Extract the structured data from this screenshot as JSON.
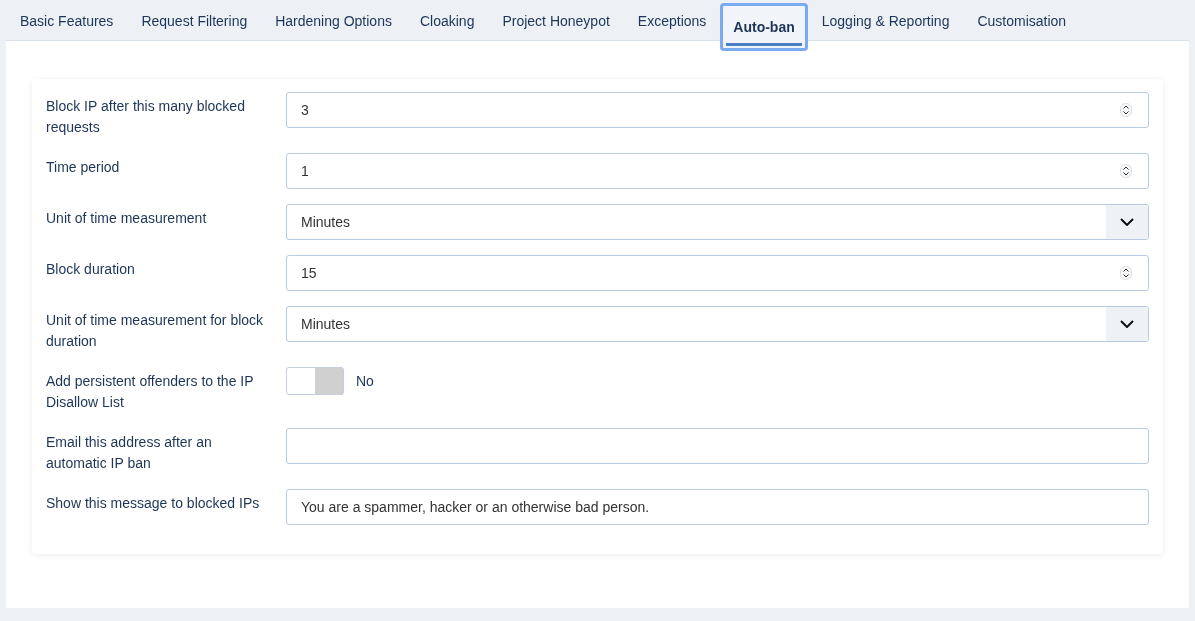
{
  "tabs": [
    {
      "label": "Basic Features",
      "selected": false
    },
    {
      "label": "Request Filtering",
      "selected": false
    },
    {
      "label": "Hardening Options",
      "selected": false
    },
    {
      "label": "Cloaking",
      "selected": false
    },
    {
      "label": "Project Honeypot",
      "selected": false
    },
    {
      "label": "Exceptions",
      "selected": false
    },
    {
      "label": "Auto-ban",
      "selected": true
    },
    {
      "label": "Logging & Reporting",
      "selected": false
    },
    {
      "label": "Customisation",
      "selected": false
    }
  ],
  "fields": [
    {
      "kind": "number",
      "label": "Block IP after this many blocked requests",
      "value": "3"
    },
    {
      "kind": "number",
      "label": "Time period",
      "value": "1"
    },
    {
      "kind": "select",
      "label": "Unit of time measurement",
      "value": "Minutes"
    },
    {
      "kind": "number",
      "label": "Block duration",
      "value": "15"
    },
    {
      "kind": "select",
      "label": "Unit of time measurement for block duration",
      "value": "Minutes"
    },
    {
      "kind": "toggle",
      "label": "Add persistent offenders to the IP Disallow List",
      "on": false,
      "value": "No"
    },
    {
      "kind": "text",
      "label": "Email this address after an automatic IP ban"
    },
    {
      "kind": "text",
      "label": "Show this message to blocked IPs",
      "value": "You are a spammer, hacker or an otherwise bad person."
    }
  ]
}
